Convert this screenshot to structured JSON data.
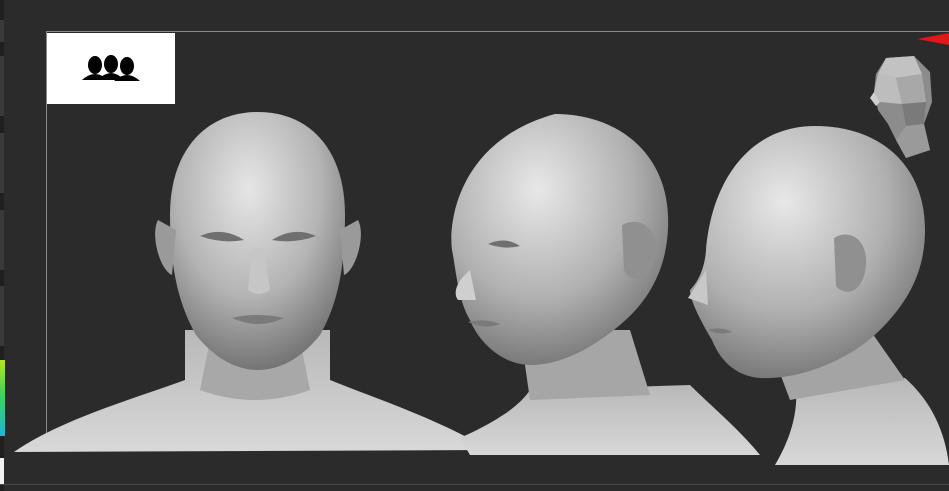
{
  "viewport": {
    "views": [
      "front-view",
      "three-quarter-view",
      "side-view"
    ]
  },
  "icons": {
    "thumbnail": "group-of-heads-icon",
    "navigator": "navigation-head-icon",
    "marker": "red-arrow-marker"
  },
  "colors": {
    "background": "#2b2b2b",
    "viewport_border": "#8a8a8a",
    "marker": "#e01818",
    "thumbnail_bg": "#ffffff"
  }
}
